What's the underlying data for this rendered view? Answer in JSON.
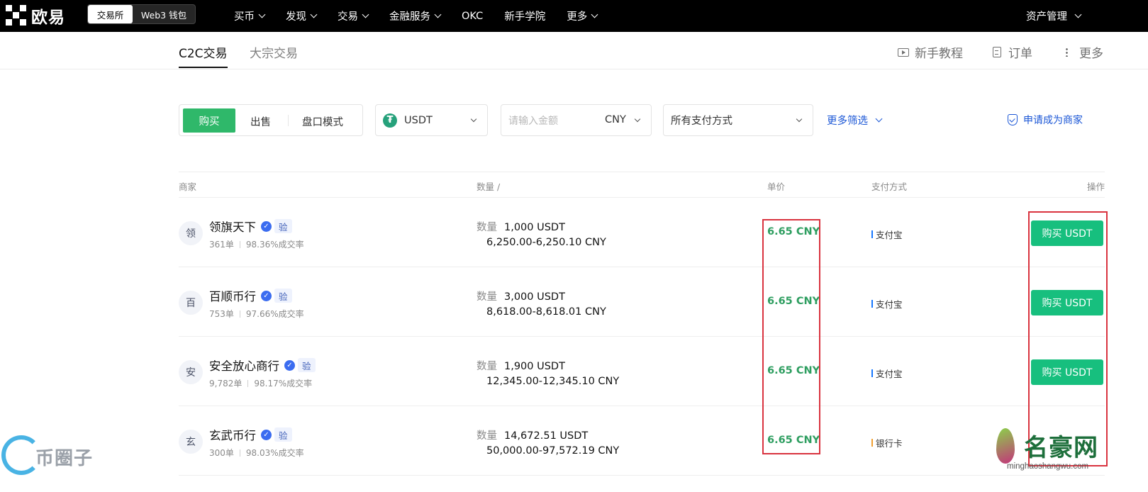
{
  "brand": {
    "name": "欧易"
  },
  "header": {
    "segment": {
      "active": "交易所",
      "inactive": "Web3 钱包"
    },
    "nav": [
      {
        "label": "买币",
        "has_dropdown": true
      },
      {
        "label": "发现",
        "has_dropdown": true
      },
      {
        "label": "交易",
        "has_dropdown": true
      },
      {
        "label": "金融服务",
        "has_dropdown": true
      },
      {
        "label": "OKC",
        "has_dropdown": false
      },
      {
        "label": "新手学院",
        "has_dropdown": false
      },
      {
        "label": "更多",
        "has_dropdown": true
      }
    ],
    "assets": "资产管理"
  },
  "subnav": {
    "tabs": [
      {
        "label": "C2C交易",
        "active": true
      },
      {
        "label": "大宗交易",
        "active": false
      }
    ],
    "links": [
      {
        "label": "新手教程",
        "icon": "video-play-icon"
      },
      {
        "label": "订单",
        "icon": "document-icon"
      },
      {
        "label": "更多",
        "icon": "more-vertical-icon"
      }
    ]
  },
  "filters": {
    "modes": {
      "buy": "购买",
      "sell": "出售",
      "book": "盘口模式",
      "active": "buy"
    },
    "coin": {
      "value": "USDT",
      "icon_glyph": "₮",
      "color": "#26a17b"
    },
    "amount": {
      "placeholder": "请输入金额",
      "currency": "CNY"
    },
    "payment": {
      "value": "所有支付方式"
    },
    "more_filters": "更多筛选",
    "apply_merchant": "申请成为商家"
  },
  "table": {
    "headers": {
      "merchant": "商家",
      "quantity": "数量 /",
      "price": "单价",
      "payment": "支付方式",
      "action": "操作"
    },
    "quantity_label": "数量",
    "rows": [
      {
        "avatar": "领",
        "name": "领旗天下",
        "verify_tag": "验",
        "orders": "361单",
        "completion": "98.36%成交率",
        "quantity": "1,000 USDT",
        "limit": "6,250.00-6,250.10 CNY",
        "price": "6.65 CNY",
        "payment": "支付宝",
        "payment_color": "#1677ff",
        "action": "购买 USDT"
      },
      {
        "avatar": "百",
        "name": "百顺币行",
        "verify_tag": "验",
        "orders": "753单",
        "completion": "97.66%成交率",
        "quantity": "3,000 USDT",
        "limit": "8,618.00-8,618.01 CNY",
        "price": "6.65 CNY",
        "payment": "支付宝",
        "payment_color": "#1677ff",
        "action": "购买 USDT"
      },
      {
        "avatar": "安",
        "name": "安全放心商行",
        "verify_tag": "验",
        "orders": "9,782单",
        "completion": "98.17%成交率",
        "quantity": "1,900 USDT",
        "limit": "12,345.00-12,345.10 CNY",
        "price": "6.65 CNY",
        "payment": "支付宝",
        "payment_color": "#1677ff",
        "action": "购买 USDT"
      },
      {
        "avatar": "玄",
        "name": "玄武币行",
        "verify_tag": "验",
        "orders": "300单",
        "completion": "98.03%成交率",
        "quantity": "14,672.51 USDT",
        "limit": "50,000.00-97,572.19 CNY",
        "price": "6.65 CNY",
        "payment": "银行卡",
        "payment_color": "#f0a030",
        "action": ""
      }
    ]
  },
  "colors": {
    "buy_green": "#2fb86a",
    "price_green": "#2e9e60",
    "link_blue": "#1a56d6",
    "highlight_red": "#d9333f"
  },
  "watermarks": {
    "left": "币圈子",
    "right_title": "名豪网",
    "right_sub": "minghaoshangwu.com"
  }
}
